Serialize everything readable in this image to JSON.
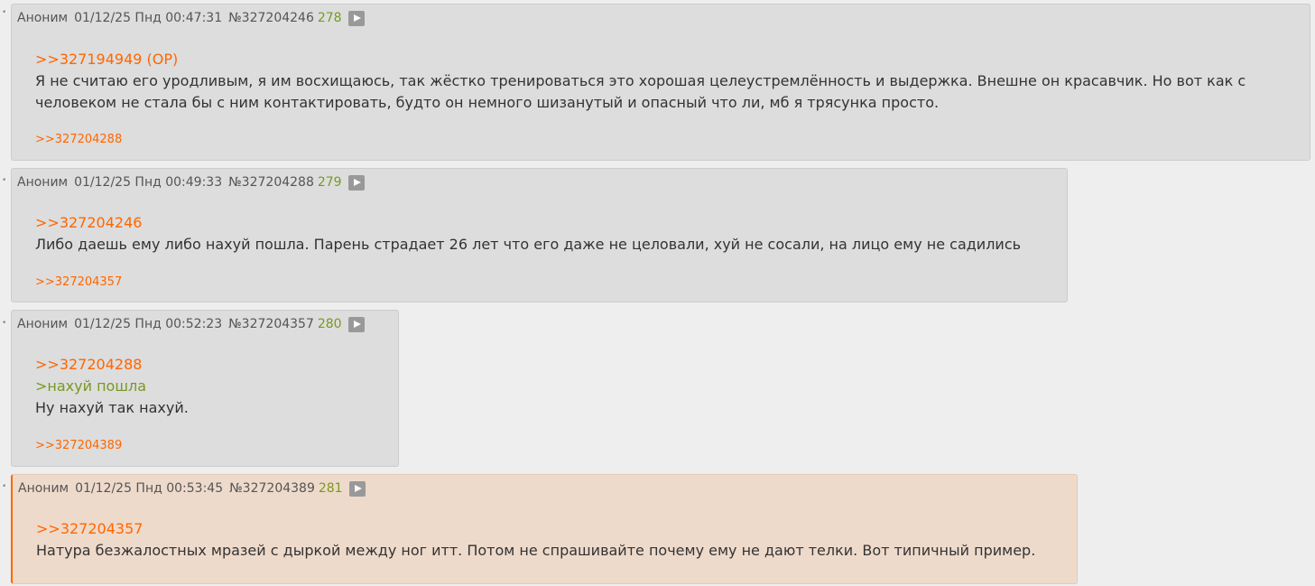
{
  "posts": [
    {
      "author": "Аноним",
      "date": "01/12/25 Пнд 00:47:31",
      "number": "№327204246",
      "count": "278",
      "reply_to": ">>327194949 (OP)",
      "text": "Я не считаю его уродливым, я им восхищаюсь, так жёстко тренироваться это хорошая целеустремлённость и выдержка. Внешне он красавчик. Но вот как с человеком не стала бы с ним контактировать, будто он немного шизанутый и опасный что ли, мб я трясунка просто.",
      "replies": ">>327204288"
    },
    {
      "author": "Аноним",
      "date": "01/12/25 Пнд 00:49:33",
      "number": "№327204288",
      "count": "279",
      "reply_to": ">>327204246",
      "text": "Либо даешь ему либо нахуй пошла. Парень страдает 26 лет что его даже не целовали, хуй не сосали, на лицо ему не садились",
      "replies": ">>327204357"
    },
    {
      "author": "Аноним",
      "date": "01/12/25 Пнд 00:52:23",
      "number": "№327204357",
      "count": "280",
      "reply_to": ">>327204288",
      "quote": ">нахуй пошла",
      "text": "Ну нахуй так нахуй.",
      "replies": ">>327204389"
    },
    {
      "author": "Аноним",
      "date": "01/12/25 Пнд 00:53:45",
      "number": "№327204389",
      "count": "281",
      "reply_to": ">>327204357",
      "text": "Натура безжалостных мразей с дыркой между ног итт. Потом не спрашивайте почему ему не дают телки. Вот типичный пример."
    }
  ],
  "colors": {
    "background": "#eeeeee",
    "post_bg": "#dddddd",
    "highlight_bg": "#eedacb",
    "link": "#ff6600",
    "quote": "#789922"
  }
}
